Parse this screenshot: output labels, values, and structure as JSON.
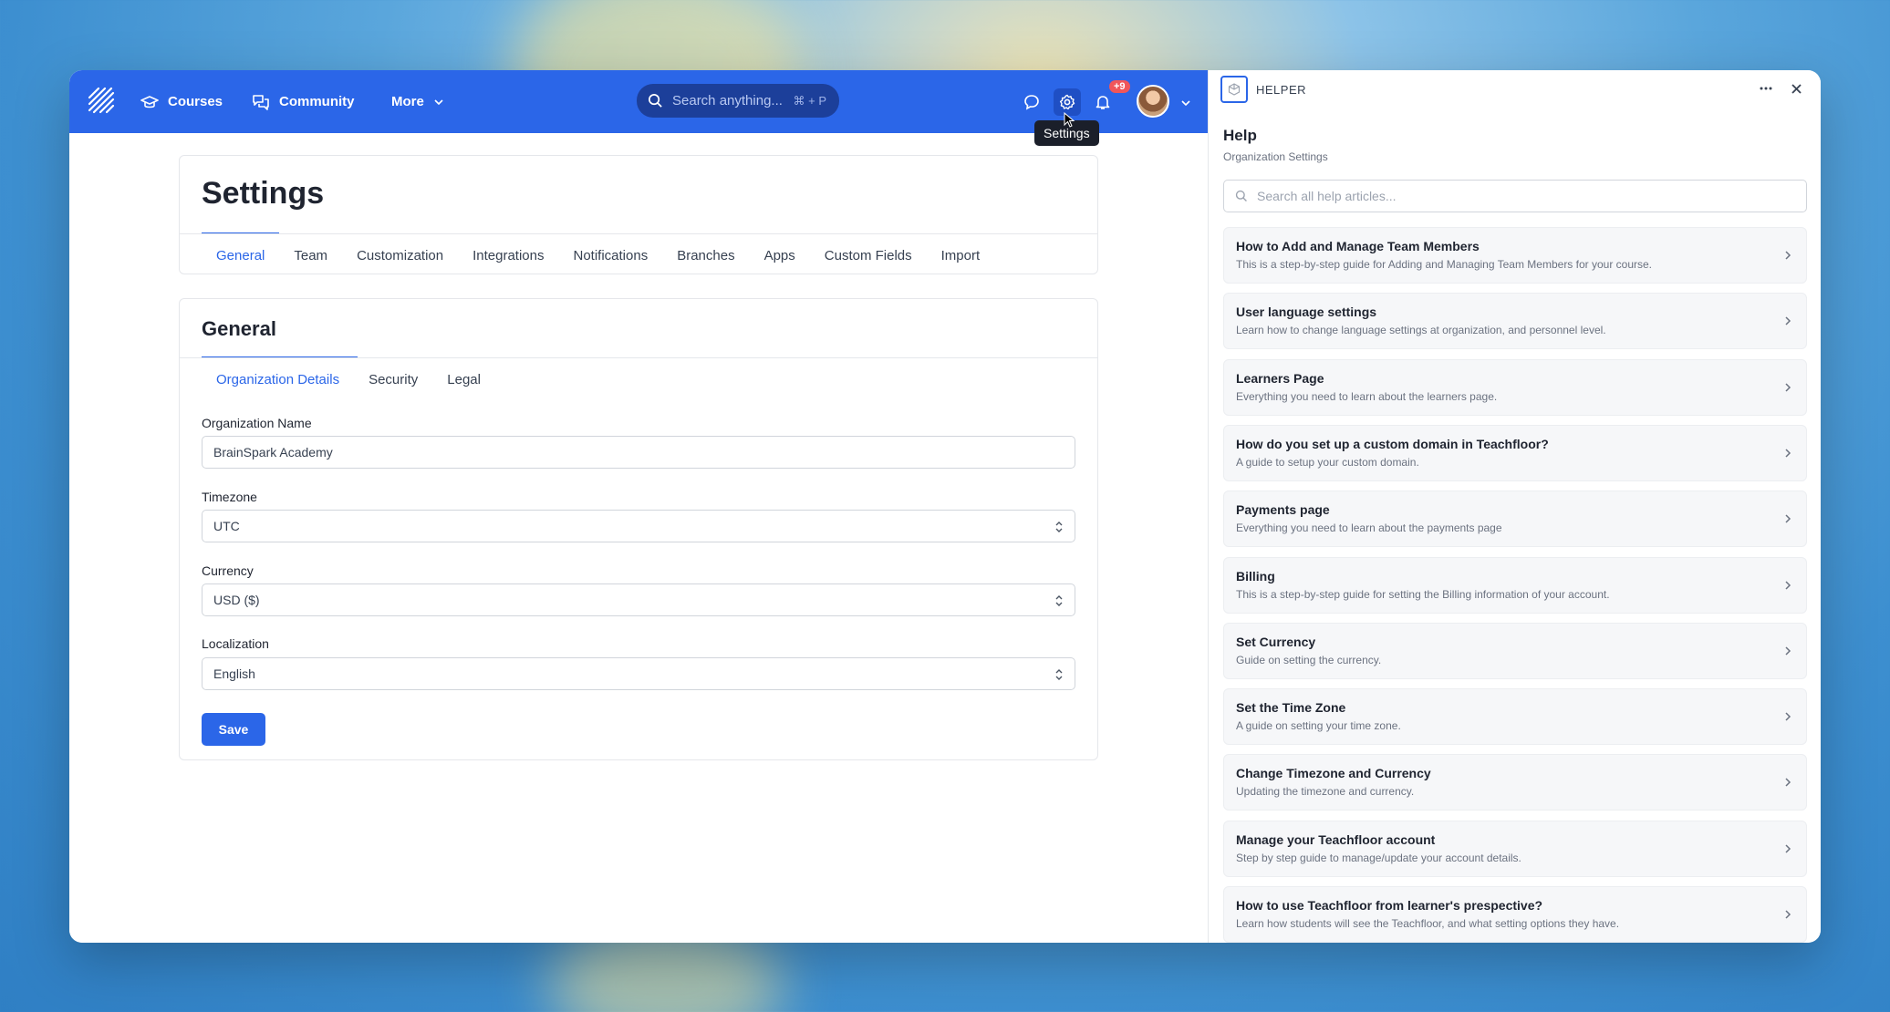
{
  "nav": {
    "items": [
      {
        "label": "Courses",
        "icon": "graduation-cap-icon"
      },
      {
        "label": "Community",
        "icon": "chat-bubbles-icon"
      },
      {
        "label": "More",
        "icon": "chevron-down-icon"
      }
    ],
    "search_placeholder": "Search anything...",
    "search_shortcut": "⌘ + P",
    "notification_count": "+9",
    "tooltip": "Settings"
  },
  "settings": {
    "title": "Settings",
    "tabs": [
      "General",
      "Team",
      "Customization",
      "Integrations",
      "Notifications",
      "Branches",
      "Apps",
      "Custom Fields",
      "Import"
    ],
    "active_tab": "General"
  },
  "general": {
    "title": "General",
    "subtabs": [
      "Organization Details",
      "Security",
      "Legal"
    ],
    "fields": {
      "org_name_label": "Organization Name",
      "org_name_value": "BrainSpark Academy",
      "timezone_label": "Timezone",
      "timezone_value": "UTC",
      "currency_label": "Currency",
      "currency_value": "USD ($)",
      "localization_label": "Localization",
      "localization_value": "English"
    },
    "save_label": "Save"
  },
  "helper": {
    "header": "HELPER",
    "title": "Help",
    "subtitle": "Organization Settings",
    "search_placeholder": "Search all help articles...",
    "articles": [
      {
        "title": "How to Add and Manage Team Members",
        "desc": "This is a step-by-step guide for Adding and Managing Team Members for your course."
      },
      {
        "title": "User language settings",
        "desc": "Learn how to change language settings at organization, and personnel level."
      },
      {
        "title": "Learners Page",
        "desc": "Everything you need to learn about the learners page."
      },
      {
        "title": "How do you set up a custom domain in Teachfloor?",
        "desc": "A guide to setup your custom domain."
      },
      {
        "title": "Payments page",
        "desc": "Everything you need to learn about the payments page"
      },
      {
        "title": "Billing",
        "desc": "This is a step-by-step guide for setting the Billing information of your account."
      },
      {
        "title": "Set Currency",
        "desc": "Guide on setting the currency."
      },
      {
        "title": "Set the Time Zone",
        "desc": "A guide on setting your time zone."
      },
      {
        "title": "Change Timezone and Currency",
        "desc": "Updating the timezone and currency."
      },
      {
        "title": "Manage your Teachfloor account",
        "desc": "Step by step guide to manage/update your account details."
      },
      {
        "title": "How to use Teachfloor from learner's prespective?",
        "desc": "Learn how students will see the Teachfloor, and what setting options they have."
      }
    ]
  },
  "colors": {
    "accent": "#2b66e8",
    "badge": "#f0565a"
  }
}
